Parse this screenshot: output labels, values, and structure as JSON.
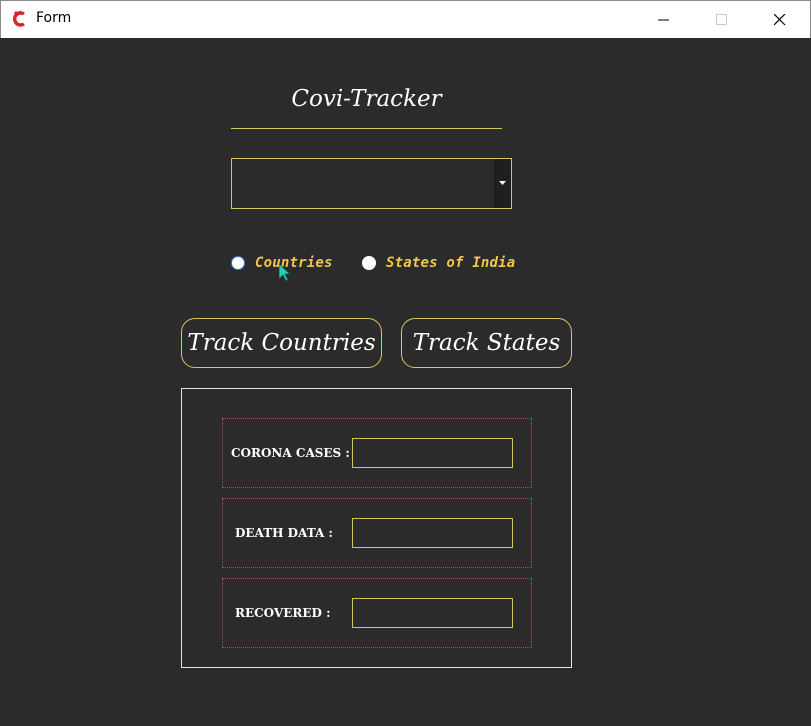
{
  "window": {
    "title": "Form",
    "icon": "app-logo-icon",
    "controls": [
      "minimize-icon",
      "maximize-icon",
      "close-icon"
    ]
  },
  "form": {
    "heading": "Covi-Tracker",
    "dropdown": {
      "value": ""
    },
    "radios": {
      "countries_label": "Countries",
      "states_label": "States of India"
    },
    "buttons": {
      "track_countries": "Track Countries",
      "track_states": "Track States"
    },
    "stats": {
      "corona_cases_label": "CORONA CASES :",
      "corona_cases_value": "",
      "death_data_label": "DEATH DATA :",
      "death_data_value": "",
      "recovered_label": "RECOVERED :",
      "recovered_value": ""
    }
  },
  "colors": {
    "background": "#2b2b2b",
    "accent_border": "#d9c45e",
    "radio_label": "#f4c64a",
    "group_border": "#a24c8f"
  }
}
